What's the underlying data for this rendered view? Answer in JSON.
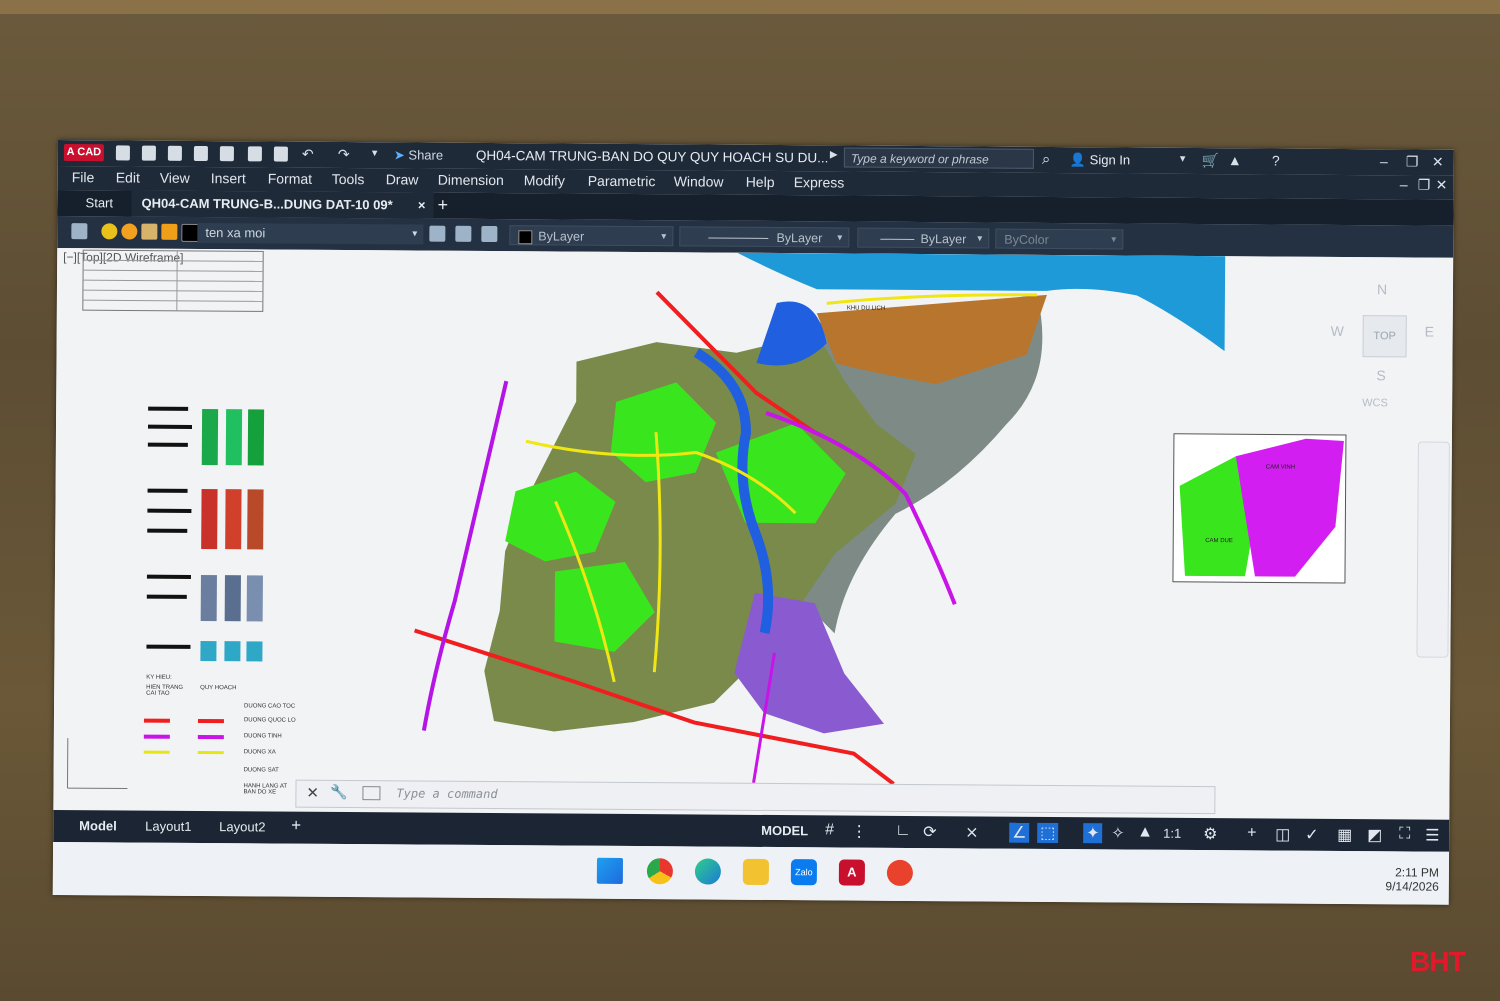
{
  "app": {
    "logo": "A CAD",
    "share_label": "Share",
    "document_title": "QH04-CAM TRUNG-BAN DO QUY QUY HOACH SU DU...",
    "search_placeholder": "Type a keyword or phrase",
    "sign_in": "Sign In"
  },
  "menu": [
    "File",
    "Edit",
    "View",
    "Insert",
    "Format",
    "Tools",
    "Draw",
    "Dimension",
    "Modify",
    "Parametric",
    "Window",
    "Help",
    "Express"
  ],
  "tabs": {
    "start": "Start",
    "document": "QH04-CAM TRUNG-B...DUNG DAT-10 09*",
    "close": "×",
    "add": "+"
  },
  "properties": {
    "layer": "ten xa moi",
    "color": "ByLayer",
    "linetype": "ByLayer",
    "lineweight": "ByLayer",
    "plotstyle": "ByColor"
  },
  "viewport_label": "[−][Top][2D Wireframe]",
  "viewcube": {
    "n": "N",
    "s": "S",
    "e": "E",
    "w": "W",
    "top": "TOP",
    "wcs": "WCS"
  },
  "legend": {
    "title": "KY HIEU:",
    "col_current": "HIEN TRANG CAI TAO",
    "col_plan": "QUY HOACH",
    "items": [
      "DUONG CAO TOC",
      "DUONG QUOC LO",
      "DUONG TINH",
      "DUONG XA",
      "DUONG SAT",
      "HANH LANG AT BAN DO XE"
    ]
  },
  "inset_labels": [
    "CAM VINH",
    "CAM DUE"
  ],
  "map_labels": [
    "KHU DU LICH"
  ],
  "command": {
    "placeholder": "Type a command"
  },
  "status": {
    "model_tab": "Model",
    "layout1": "Layout1",
    "layout2": "Layout2",
    "add": "+",
    "model_button": "MODEL",
    "scale": "1:1"
  },
  "taskbar": {
    "time": "2:11 PM",
    "date": "9/14/2026"
  },
  "watermark": "BHT",
  "colors": {
    "accent": "#c8102e",
    "titlebar": "#1f2a38",
    "land_green": "#39e61e",
    "land_purple": "#c814e6",
    "road_red": "#f01e1e",
    "water_blue": "#1f5fe0"
  }
}
